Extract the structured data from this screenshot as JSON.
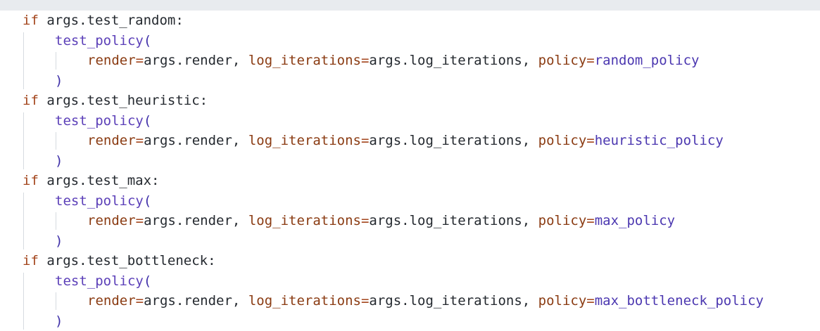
{
  "lines": [
    {
      "indent": 0,
      "tokens": [
        {
          "t": "if",
          "c": "kw"
        },
        {
          "t": " args.test_random:",
          "c": "tx"
        }
      ]
    },
    {
      "indent": 1,
      "tokens": [
        {
          "t": "test_policy",
          "c": "fn"
        },
        {
          "t": "(",
          "c": "pn"
        }
      ]
    },
    {
      "indent": 2,
      "tokens": [
        {
          "t": "render",
          "c": "pv"
        },
        {
          "t": "=",
          "c": "op"
        },
        {
          "t": "args.render, ",
          "c": "tx"
        },
        {
          "t": "log_iterations",
          "c": "pv"
        },
        {
          "t": "=",
          "c": "op"
        },
        {
          "t": "args.log_iterations, ",
          "c": "tx"
        },
        {
          "t": "policy",
          "c": "pv"
        },
        {
          "t": "=",
          "c": "op"
        },
        {
          "t": "random_policy",
          "c": "val"
        }
      ]
    },
    {
      "indent": 1,
      "tokens": [
        {
          "t": ")",
          "c": "pn"
        }
      ]
    },
    {
      "indent": 0,
      "tokens": [
        {
          "t": "if",
          "c": "kw"
        },
        {
          "t": " args.test_heuristic:",
          "c": "tx"
        }
      ]
    },
    {
      "indent": 1,
      "tokens": [
        {
          "t": "test_policy",
          "c": "fn"
        },
        {
          "t": "(",
          "c": "pn"
        }
      ]
    },
    {
      "indent": 2,
      "tokens": [
        {
          "t": "render",
          "c": "pv"
        },
        {
          "t": "=",
          "c": "op"
        },
        {
          "t": "args.render, ",
          "c": "tx"
        },
        {
          "t": "log_iterations",
          "c": "pv"
        },
        {
          "t": "=",
          "c": "op"
        },
        {
          "t": "args.log_iterations, ",
          "c": "tx"
        },
        {
          "t": "policy",
          "c": "pv"
        },
        {
          "t": "=",
          "c": "op"
        },
        {
          "t": "heuristic_policy",
          "c": "val"
        }
      ]
    },
    {
      "indent": 1,
      "tokens": [
        {
          "t": ")",
          "c": "pn"
        }
      ]
    },
    {
      "indent": 0,
      "tokens": [
        {
          "t": "if",
          "c": "kw"
        },
        {
          "t": " args.test_max:",
          "c": "tx"
        }
      ]
    },
    {
      "indent": 1,
      "tokens": [
        {
          "t": "test_policy",
          "c": "fn"
        },
        {
          "t": "(",
          "c": "pn"
        }
      ]
    },
    {
      "indent": 2,
      "tokens": [
        {
          "t": "render",
          "c": "pv"
        },
        {
          "t": "=",
          "c": "op"
        },
        {
          "t": "args.render, ",
          "c": "tx"
        },
        {
          "t": "log_iterations",
          "c": "pv"
        },
        {
          "t": "=",
          "c": "op"
        },
        {
          "t": "args.log_iterations, ",
          "c": "tx"
        },
        {
          "t": "policy",
          "c": "pv"
        },
        {
          "t": "=",
          "c": "op"
        },
        {
          "t": "max_policy",
          "c": "val"
        }
      ]
    },
    {
      "indent": 1,
      "tokens": [
        {
          "t": ")",
          "c": "pn"
        }
      ]
    },
    {
      "indent": 0,
      "tokens": [
        {
          "t": "if",
          "c": "kw"
        },
        {
          "t": " args.test_bottleneck:",
          "c": "tx"
        }
      ]
    },
    {
      "indent": 1,
      "tokens": [
        {
          "t": "test_policy",
          "c": "fn"
        },
        {
          "t": "(",
          "c": "pn"
        }
      ]
    },
    {
      "indent": 2,
      "tokens": [
        {
          "t": "render",
          "c": "pv"
        },
        {
          "t": "=",
          "c": "op"
        },
        {
          "t": "args.render, ",
          "c": "tx"
        },
        {
          "t": "log_iterations",
          "c": "pv"
        },
        {
          "t": "=",
          "c": "op"
        },
        {
          "t": "args.log_iterations, ",
          "c": "tx"
        },
        {
          "t": "policy",
          "c": "pv"
        },
        {
          "t": "=",
          "c": "op"
        },
        {
          "t": "max_bottleneck_policy",
          "c": "val"
        }
      ]
    },
    {
      "indent": 1,
      "tokens": [
        {
          "t": ")",
          "c": "pn"
        }
      ]
    }
  ]
}
